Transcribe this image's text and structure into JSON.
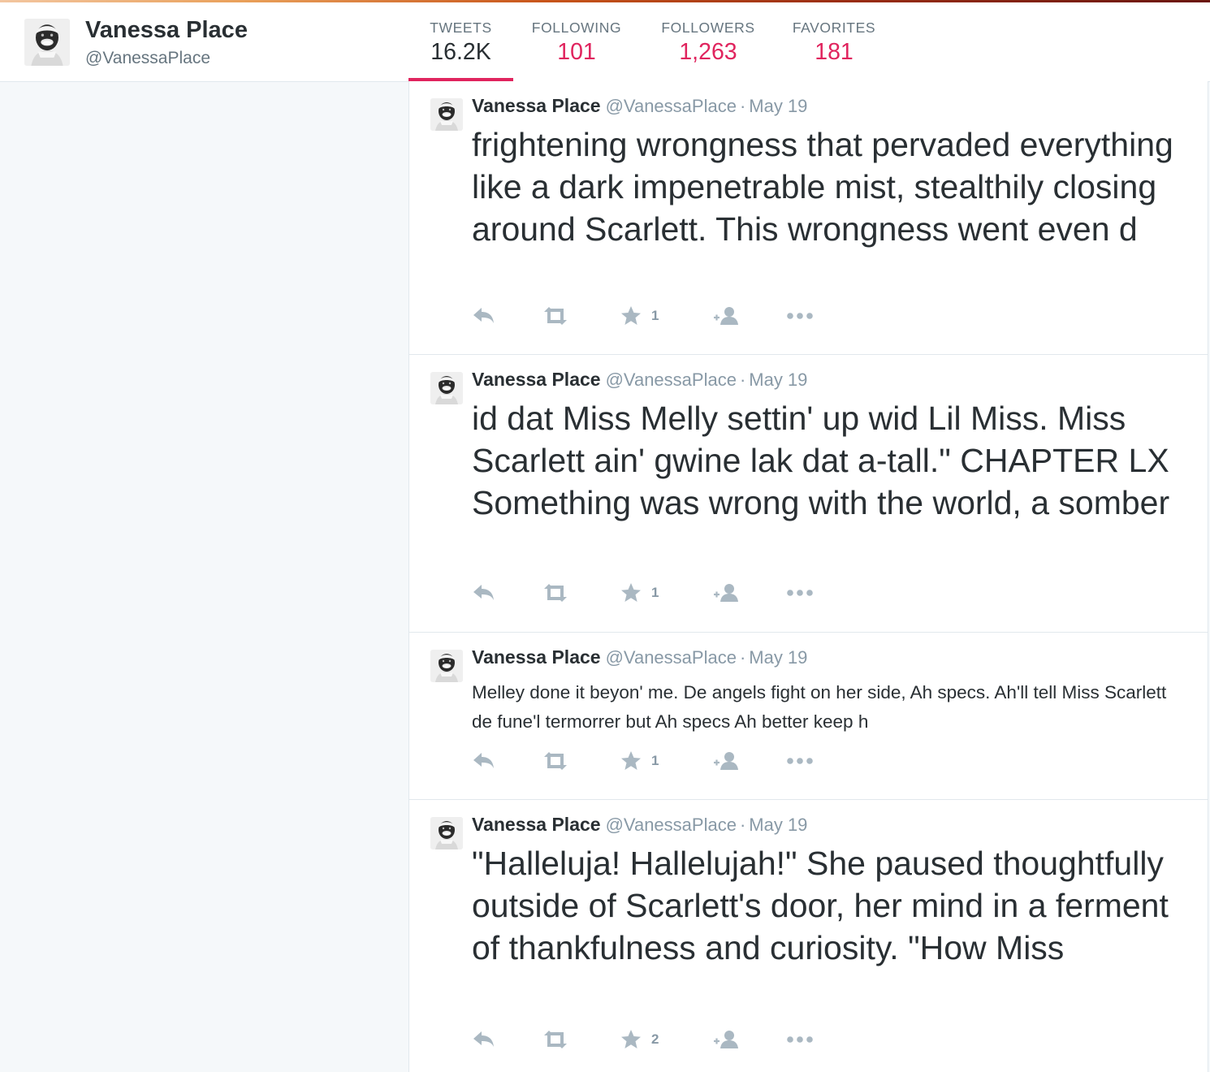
{
  "profile": {
    "name": "Vanessa Place",
    "handle": "@VanessaPlace"
  },
  "stats": [
    {
      "label": "TWEETS",
      "value": "16.2K"
    },
    {
      "label": "FOLLOWING",
      "value": "101"
    },
    {
      "label": "FOLLOWERS",
      "value": "1,263"
    },
    {
      "label": "FAVORITES",
      "value": "181"
    }
  ],
  "colors": {
    "accent": "#e0245e",
    "text": "#292f33",
    "muted": "#8899a6",
    "icon": "#aab8c2"
  },
  "tweets": [
    {
      "name": "Vanessa Place",
      "handle": "@VanessaPlace",
      "dot": "·",
      "time": "May 19",
      "text": "frightening wrongness that pervaded everything like a dark impenetrable mist, stealthily closing around Scarlett. This wrongness went even d",
      "favorites": "1",
      "icons": [
        "reply-icon",
        "retweet-icon",
        "star-icon",
        "follow-icon",
        "more-icon"
      ]
    },
    {
      "name": "Vanessa Place",
      "handle": "@VanessaPlace",
      "dot": "·",
      "time": "May 19",
      "text": "id dat Miss Melly settin' up wid Lil Miss. Miss Scarlett ain' gwine lak dat a-tall.\" CHAPTER LX Something was wrong with the world, a somber",
      "favorites": "1",
      "icons": [
        "reply-icon",
        "retweet-icon",
        "star-icon",
        "follow-icon",
        "more-icon"
      ]
    },
    {
      "name": "Vanessa Place",
      "handle": "@VanessaPlace",
      "dot": "·",
      "time": "May 19",
      "text": "Melley done it beyon' me. De angels fight on her side, Ah specs. Ah'll tell Miss Scarlett de fune'l termorrer but Ah specs Ah better keep h",
      "favorites": "1",
      "icons": [
        "reply-icon",
        "retweet-icon",
        "star-icon",
        "follow-icon",
        "more-icon"
      ]
    },
    {
      "name": "Vanessa Place",
      "handle": "@VanessaPlace",
      "dot": "·",
      "time": "May 19",
      "text": "\"Halleluja! Hallelujah!\" She paused thoughtfully outside of Scarlett's door, her mind in a ferment of thankfulness and curiosity. \"How Miss",
      "favorites": "2",
      "icons": [
        "reply-icon",
        "retweet-icon",
        "star-icon",
        "follow-icon",
        "more-icon"
      ]
    }
  ]
}
